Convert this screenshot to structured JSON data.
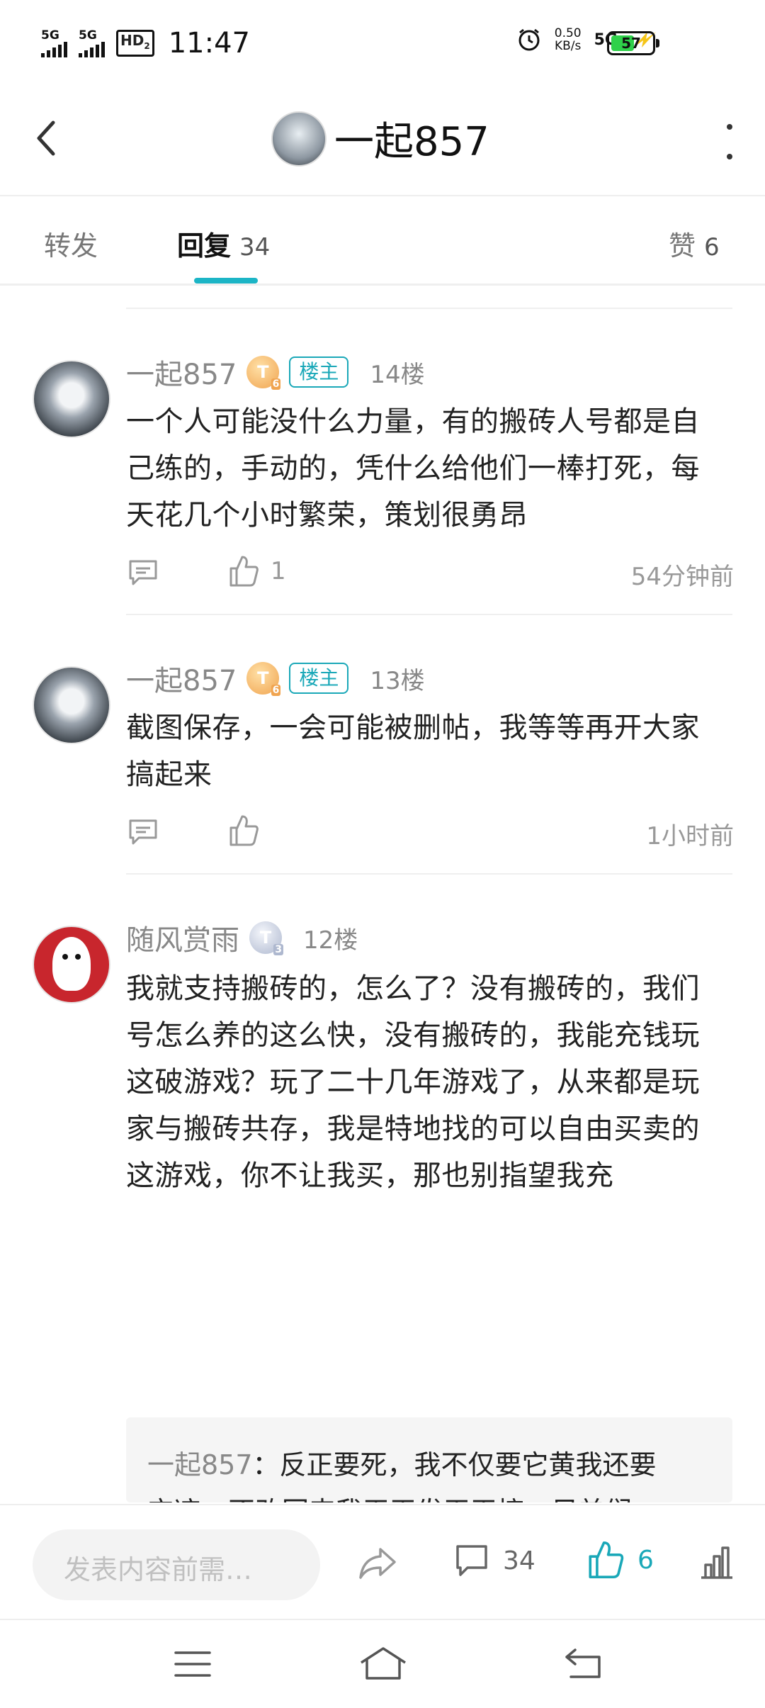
{
  "status_bar": {
    "sim1": "5G",
    "sim2": "5G",
    "hd": "HD",
    "hd_sub": "2",
    "time": "11:47",
    "speed_value": "0.50",
    "speed_unit": "KB/s",
    "network": "5G",
    "battery": "57",
    "battery_level": 0.57
  },
  "header": {
    "title": "一起857",
    "back_icon": "chevron-left-icon",
    "more_icon": "more-vertical-icon"
  },
  "tabs": {
    "repost": "转发",
    "reply": "回复",
    "reply_count": "34",
    "like": "赞",
    "like_count": "6"
  },
  "comments": [
    {
      "user": "一起857",
      "level": "T",
      "level_num": "6",
      "badge": "楼主",
      "floor": "14楼",
      "text": "一个人可能没什么力量，有的搬砖人号都是自己练的，手动的，凭什么给他们一棒打死，每天花几个小时繁荣，策划很勇昂",
      "likes": "1",
      "time": "54分钟前"
    },
    {
      "user": "一起857",
      "level": "T",
      "level_num": "6",
      "badge": "楼主",
      "floor": "13楼",
      "text": "截图保存，一会可能被删帖，我等等再开大家搞起来",
      "likes": "",
      "time": "1小时前"
    },
    {
      "user": "随风赏雨",
      "level": "T",
      "level_num": "3",
      "floor": "12楼",
      "text": "我就支持搬砖的，怎么了？没有搬砖的，我们号怎么养的这么快，没有搬砖的，我能充钱玩这破游戏？玩了二十几年游戏了，从来都是玩家与搬砖共存，我是特地找的可以自由买卖的这游戏，你不让我买，那也别指望我充"
    }
  ],
  "quote": {
    "name": "一起857",
    "sep": "：",
    "text_line1": "反正要死，我不仅要它黄我还要",
    "text_line2": "它凉，不改回来我天天发天天搞，兄弟们"
  },
  "bottom_bar": {
    "input_placeholder": "发表内容前需…",
    "comment_count": "34",
    "like_count": "6"
  },
  "colors": {
    "accent": "#1cb5c6",
    "badge": "#1aa8b8",
    "level_gold": "#f0a450",
    "level_silver": "#aeb8cf"
  }
}
